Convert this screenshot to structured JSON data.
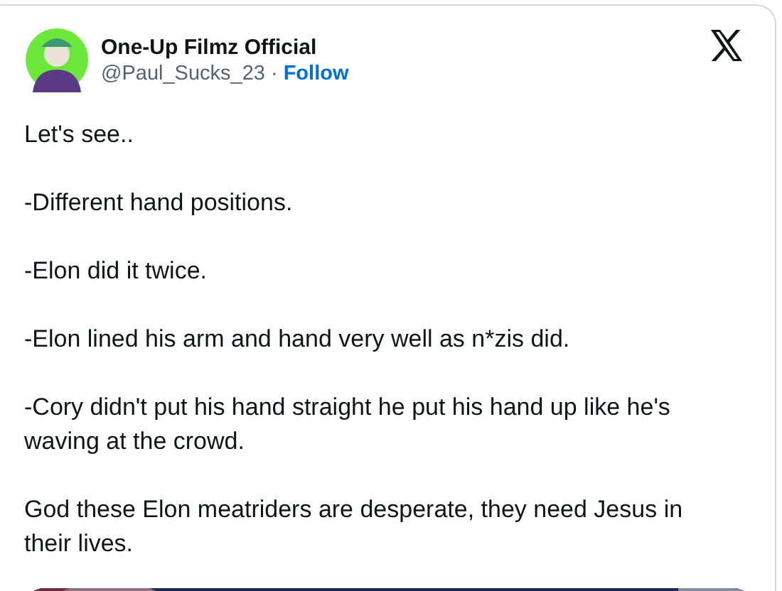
{
  "tweet": {
    "author": {
      "name": "One-Up Filmz Official",
      "handle": "@Paul_Sucks_23",
      "separator": "·",
      "follow": "Follow"
    },
    "paragraphs": [
      "Let's see..",
      "-Different hand positions.",
      "-Elon did it twice.",
      "-Elon lined his arm and hand very well as n*zis did.",
      "-Cory didn't put his hand straight he put his hand up like he's waving at the crowd.",
      "God these Elon meatriders are desperate, they need Jesus in their lives."
    ]
  }
}
